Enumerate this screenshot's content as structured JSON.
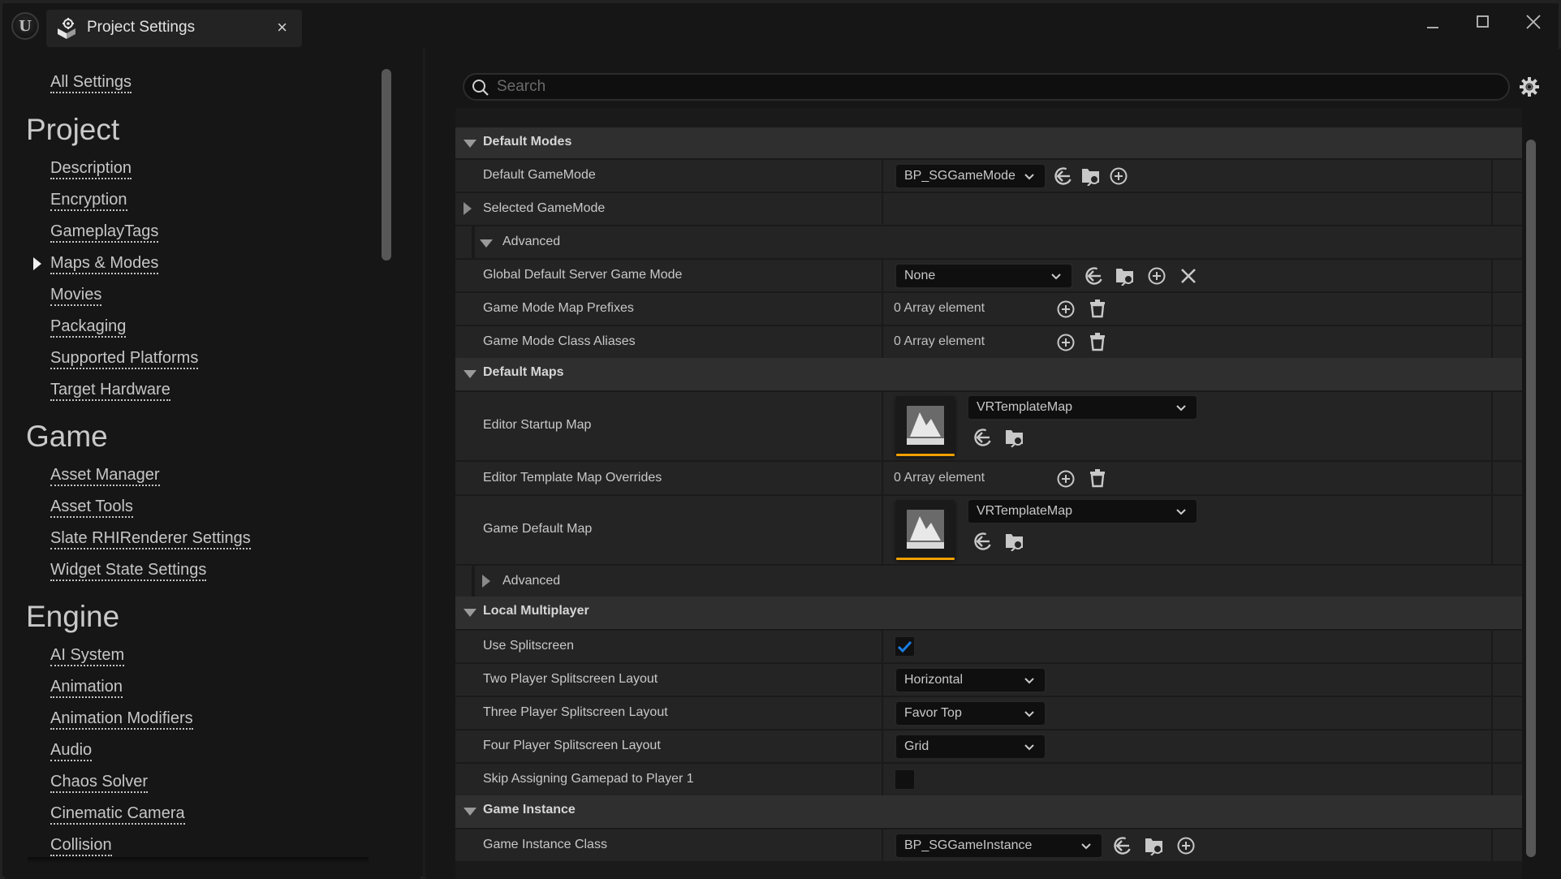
{
  "window": {
    "tab_title": "Project Settings",
    "tab_icon": "project-settings-icon",
    "logo_icon": "unreal-logo-icon",
    "controls": [
      "minimize-icon",
      "maximize-icon",
      "close-icon"
    ]
  },
  "sidebar": {
    "all_settings": "All Settings",
    "categories": [
      {
        "title": "Project",
        "items": [
          {
            "label": "Description"
          },
          {
            "label": "Encryption"
          },
          {
            "label": "GameplayTags"
          },
          {
            "label": "Maps & Modes",
            "selected": true
          },
          {
            "label": "Movies"
          },
          {
            "label": "Packaging"
          },
          {
            "label": "Supported Platforms"
          },
          {
            "label": "Target Hardware"
          }
        ]
      },
      {
        "title": "Game",
        "items": [
          {
            "label": "Asset Manager"
          },
          {
            "label": "Asset Tools"
          },
          {
            "label": "Slate RHIRenderer Settings"
          },
          {
            "label": "Widget State Settings"
          }
        ]
      },
      {
        "title": "Engine",
        "items": [
          {
            "label": "AI System"
          },
          {
            "label": "Animation"
          },
          {
            "label": "Animation Modifiers"
          },
          {
            "label": "Audio"
          },
          {
            "label": "Chaos Solver"
          },
          {
            "label": "Cinematic Camera"
          },
          {
            "label": "Collision"
          }
        ]
      }
    ]
  },
  "search": {
    "placeholder": "Search",
    "value": ""
  },
  "sections": {
    "default_modes": {
      "title": "Default Modes",
      "default_gamemode": {
        "label": "Default GameMode",
        "value": "BP_SGGameMode"
      },
      "selected_gamemode": {
        "label": "Selected GameMode"
      },
      "advanced": {
        "label": "Advanced",
        "expanded": true
      },
      "global_default_server_game_mode": {
        "label": "Global Default Server Game Mode",
        "value": "None"
      },
      "game_mode_map_prefixes": {
        "label": "Game Mode Map Prefixes",
        "value": "0 Array element"
      },
      "game_mode_class_aliases": {
        "label": "Game Mode Class Aliases",
        "value": "0 Array element"
      }
    },
    "default_maps": {
      "title": "Default Maps",
      "editor_startup_map": {
        "label": "Editor Startup Map",
        "value": "VRTemplateMap"
      },
      "editor_template_map_overrides": {
        "label": "Editor Template Map Overrides",
        "value": "0 Array element"
      },
      "game_default_map": {
        "label": "Game Default Map",
        "value": "VRTemplateMap"
      },
      "advanced": {
        "label": "Advanced",
        "expanded": false
      }
    },
    "local_multiplayer": {
      "title": "Local Multiplayer",
      "use_splitscreen": {
        "label": "Use Splitscreen",
        "checked": true
      },
      "two_player_layout": {
        "label": "Two Player Splitscreen Layout",
        "value": "Horizontal"
      },
      "three_player_layout": {
        "label": "Three Player Splitscreen Layout",
        "value": "Favor Top"
      },
      "four_player_layout": {
        "label": "Four Player Splitscreen Layout",
        "value": "Grid"
      },
      "skip_gamepad": {
        "label": "Skip Assigning Gamepad to Player 1",
        "checked": false
      }
    },
    "game_instance": {
      "title": "Game Instance",
      "game_instance_class": {
        "label": "Game Instance Class",
        "value": "BP_SGGameInstance"
      }
    }
  },
  "colors": {
    "accent_check": "#1a7ee6",
    "thumbnail_underline": "#f0a000",
    "section_header_bg": "#2f2f2f",
    "row_bg": "#242424"
  }
}
